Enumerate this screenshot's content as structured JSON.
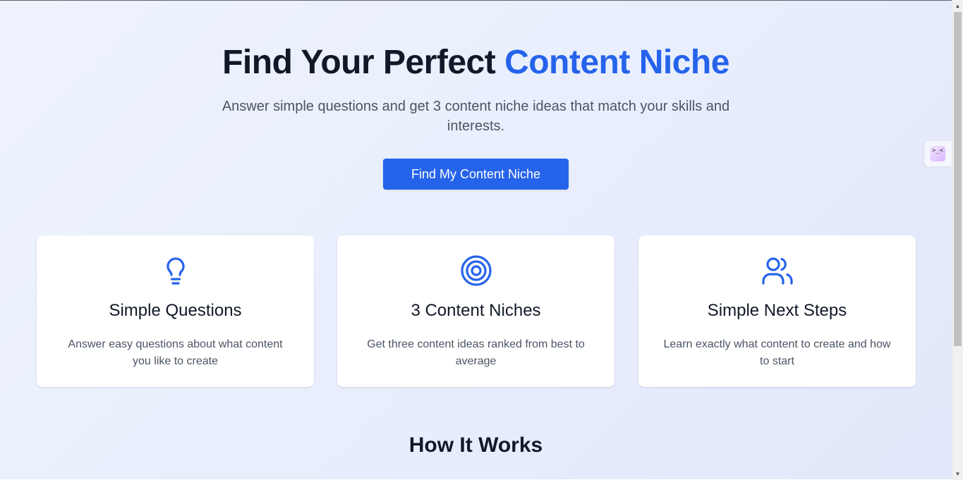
{
  "hero": {
    "title_part1": "Find Your Perfect ",
    "title_accent": "Content Niche",
    "subtitle": "Answer simple questions and get 3 content niche ideas that match your skills and interests.",
    "cta_label": "Find My Content Niche"
  },
  "features": [
    {
      "icon": "lightbulb-icon",
      "title": "Simple Questions",
      "description": "Answer easy questions about what content you like to create"
    },
    {
      "icon": "target-icon",
      "title": "3 Content Niches",
      "description": "Get three content ideas ranked from best to average"
    },
    {
      "icon": "users-icon",
      "title": "Simple Next Steps",
      "description": "Learn exactly what content to create and how to start"
    }
  ],
  "how_it_works": {
    "title": "How It Works"
  },
  "side_widget": {
    "glyph": ">_<"
  },
  "colors": {
    "accent": "#2563eb",
    "heading": "#111827",
    "body_text": "#4b5563",
    "background": "#e8eefc",
    "card": "#ffffff"
  },
  "scrollbar": {
    "up_glyph": "▲",
    "down_glyph": "▼"
  }
}
